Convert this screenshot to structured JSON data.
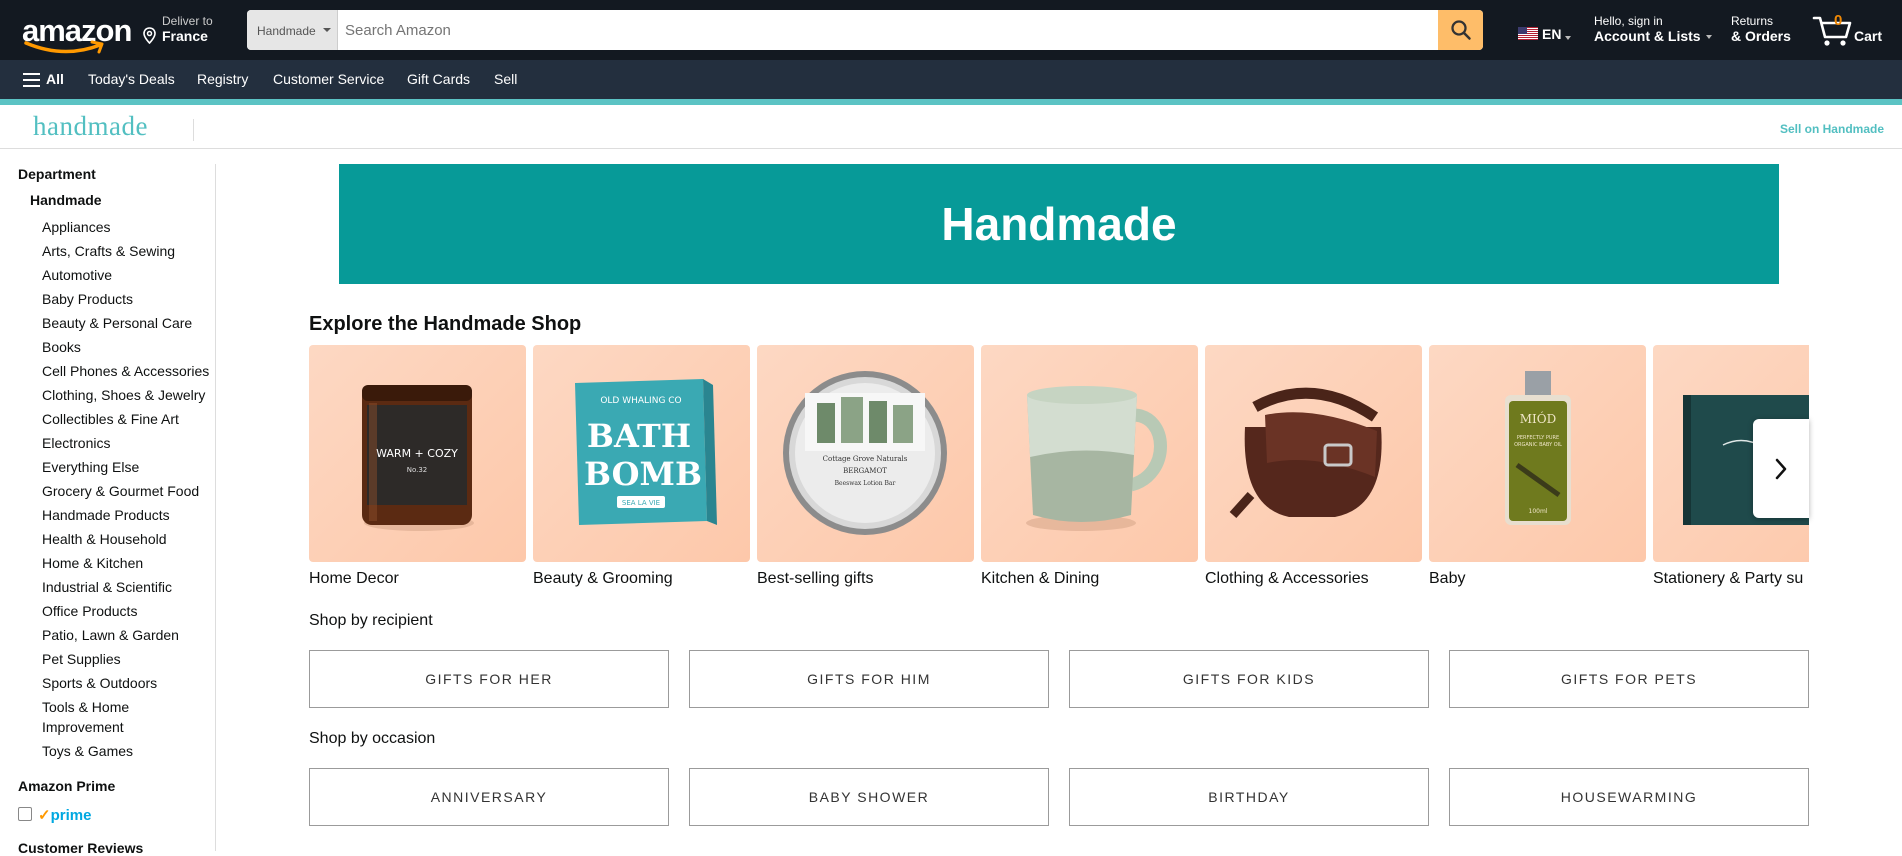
{
  "header": {
    "logo_text": "amazon",
    "deliver_label": "Deliver to",
    "deliver_location": "France",
    "search_category": "Handmade",
    "search_placeholder": "Search Amazon",
    "language": "EN",
    "account_greeting": "Hello, sign in",
    "account_label": "Account & Lists",
    "returns_label": "Returns",
    "orders_label": "& Orders",
    "cart_count": "0",
    "cart_label": "Cart"
  },
  "nav": {
    "all_label": "All",
    "items": [
      "Today's Deals",
      "Registry",
      "Customer Service",
      "Gift Cards",
      "Sell"
    ]
  },
  "subnav": {
    "logo_text": "handmade",
    "sell_link": "Sell on Handmade"
  },
  "sidebar": {
    "department_heading": "Department",
    "current": "Handmade",
    "departments": [
      "Appliances",
      "Arts, Crafts & Sewing",
      "Automotive",
      "Baby Products",
      "Beauty & Personal Care",
      "Books",
      "Cell Phones & Accessories",
      "Clothing, Shoes & Jewelry",
      "Collectibles & Fine Art",
      "Electronics",
      "Everything Else",
      "Grocery & Gourmet Food",
      "Handmade Products",
      "Health & Household",
      "Home & Kitchen",
      "Industrial & Scientific",
      "Office Products",
      "Patio, Lawn & Garden",
      "Pet Supplies",
      "Sports & Outdoors",
      "Tools & Home",
      "Improvement",
      "Toys & Games"
    ],
    "prime_heading": "Amazon Prime",
    "prime_logo": "prime",
    "reviews_heading": "Customer Reviews"
  },
  "main": {
    "banner_title": "Handmade",
    "explore_heading": "Explore the Handmade Shop",
    "categories": [
      {
        "label": "Home Decor",
        "product_text": [
          "WARM + COZY",
          "No.32"
        ]
      },
      {
        "label": "Beauty & Grooming",
        "product_text": [
          "OLD WHALING CO",
          "BATH",
          "BOMB",
          "SEA LA VIE"
        ]
      },
      {
        "label": "Best-selling gifts",
        "product_text": [
          "Cottage Grove Naturals",
          "BERGAMOT",
          "Beeswax Lotion Bar"
        ]
      },
      {
        "label": "Kitchen & Dining",
        "product_text": []
      },
      {
        "label": "Clothing & Accessories",
        "product_text": []
      },
      {
        "label": "Baby",
        "product_text": [
          "MIÓD",
          "PERFECTLY PURE",
          "ORGANIC BABY OIL",
          "100ml"
        ]
      },
      {
        "label": "Stationery & Party su",
        "product_text": []
      }
    ],
    "recipient_heading": "Shop by recipient",
    "recipients": [
      "GIFTS FOR HER",
      "GIFTS FOR HIM",
      "GIFTS FOR KIDS",
      "GIFTS FOR PETS"
    ],
    "occasion_heading": "Shop by occasion",
    "occasions": [
      "ANNIVERSARY",
      "BABY SHOWER",
      "BIRTHDAY",
      "HOUSEWARMING"
    ]
  },
  "colors": {
    "header_bg": "#131921",
    "nav_bg": "#232f3e",
    "search_button": "#febd69",
    "handmade_teal": "#079a98",
    "handmade_accent": "#52bfc1",
    "cart_count": "#f08804"
  }
}
